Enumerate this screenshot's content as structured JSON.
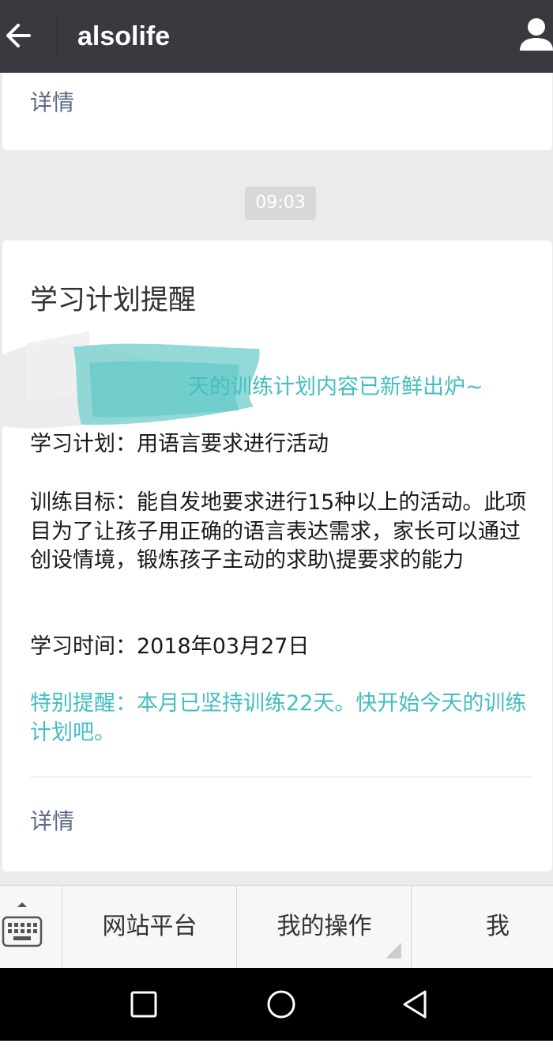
{
  "header": {
    "title": "alsolife",
    "back_icon": "arrow-left-icon",
    "profile_icon": "person-icon"
  },
  "previous_card": {
    "detail_label": "详情"
  },
  "timestamp": "09:03",
  "message": {
    "title": "学习计划提醒",
    "intro_visible": "天的训练计划内容已新鲜出炉~",
    "plan_label": "学习计划：",
    "plan_value": "用语言要求进行活动",
    "goal_label": "训练目标：",
    "goal_value": "能自发地要求进行15种以上的活动。此项目为了让孩子用正确的语言表达需求，家长可以通过创设情境，锻炼孩子主动的求助\\提要求的能力",
    "time_label": "学习时间：",
    "time_value": "2018年03月27日",
    "reminder": "特别提醒：本月已坚持训练22天。快开始今天的训练计划吧。",
    "detail_label": "详情"
  },
  "menu": {
    "keyboard_icon": "keyboard-icon",
    "items": [
      {
        "label": "网站平台"
      },
      {
        "label": "我的操作"
      },
      {
        "label": "我"
      }
    ]
  },
  "navbar": {
    "recent_icon": "square-icon",
    "home_icon": "circle-icon",
    "back_icon": "triangle-back-icon"
  },
  "colors": {
    "topbar": "#393a3f",
    "accent_teal": "#46bdc0",
    "link": "#5a6b85",
    "background": "#ebebeb"
  }
}
